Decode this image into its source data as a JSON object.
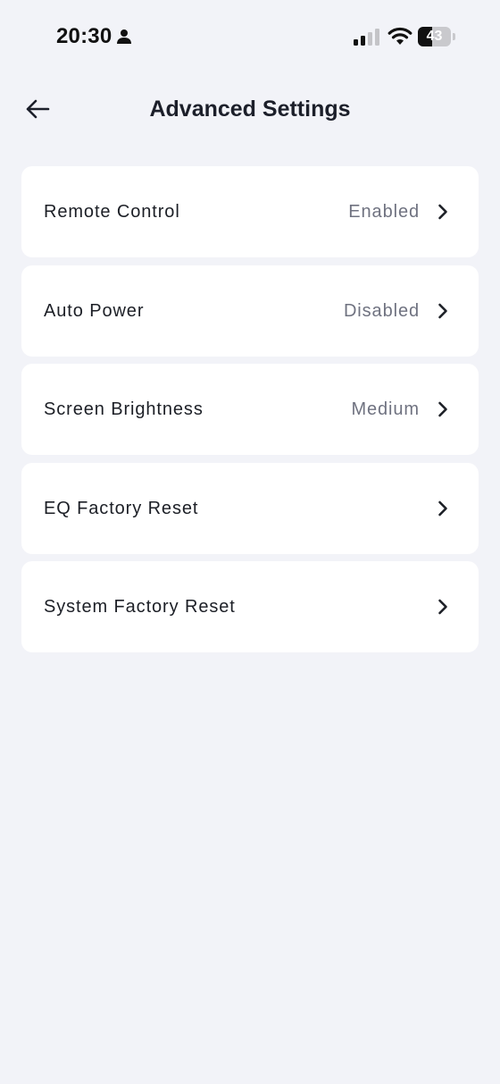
{
  "status_bar": {
    "time": "20:30",
    "battery_level": "43",
    "battery_fraction": 0.43,
    "icons": [
      "person-icon",
      "signal-icon",
      "wifi-icon",
      "battery-icon"
    ]
  },
  "header": {
    "title": "Advanced Settings",
    "back_icon": "arrow-left-icon"
  },
  "settings": {
    "items": [
      {
        "label": "Remote Control",
        "value": "Enabled"
      },
      {
        "label": "Auto Power",
        "value": "Disabled"
      },
      {
        "label": "Screen Brightness",
        "value": "Medium"
      },
      {
        "label": "EQ Factory Reset",
        "value": ""
      },
      {
        "label": "System Factory Reset",
        "value": ""
      }
    ]
  },
  "colors": {
    "background": "#f2f3f8",
    "card": "#ffffff",
    "text_primary": "#1c1f26",
    "text_secondary": "#6f7280"
  }
}
